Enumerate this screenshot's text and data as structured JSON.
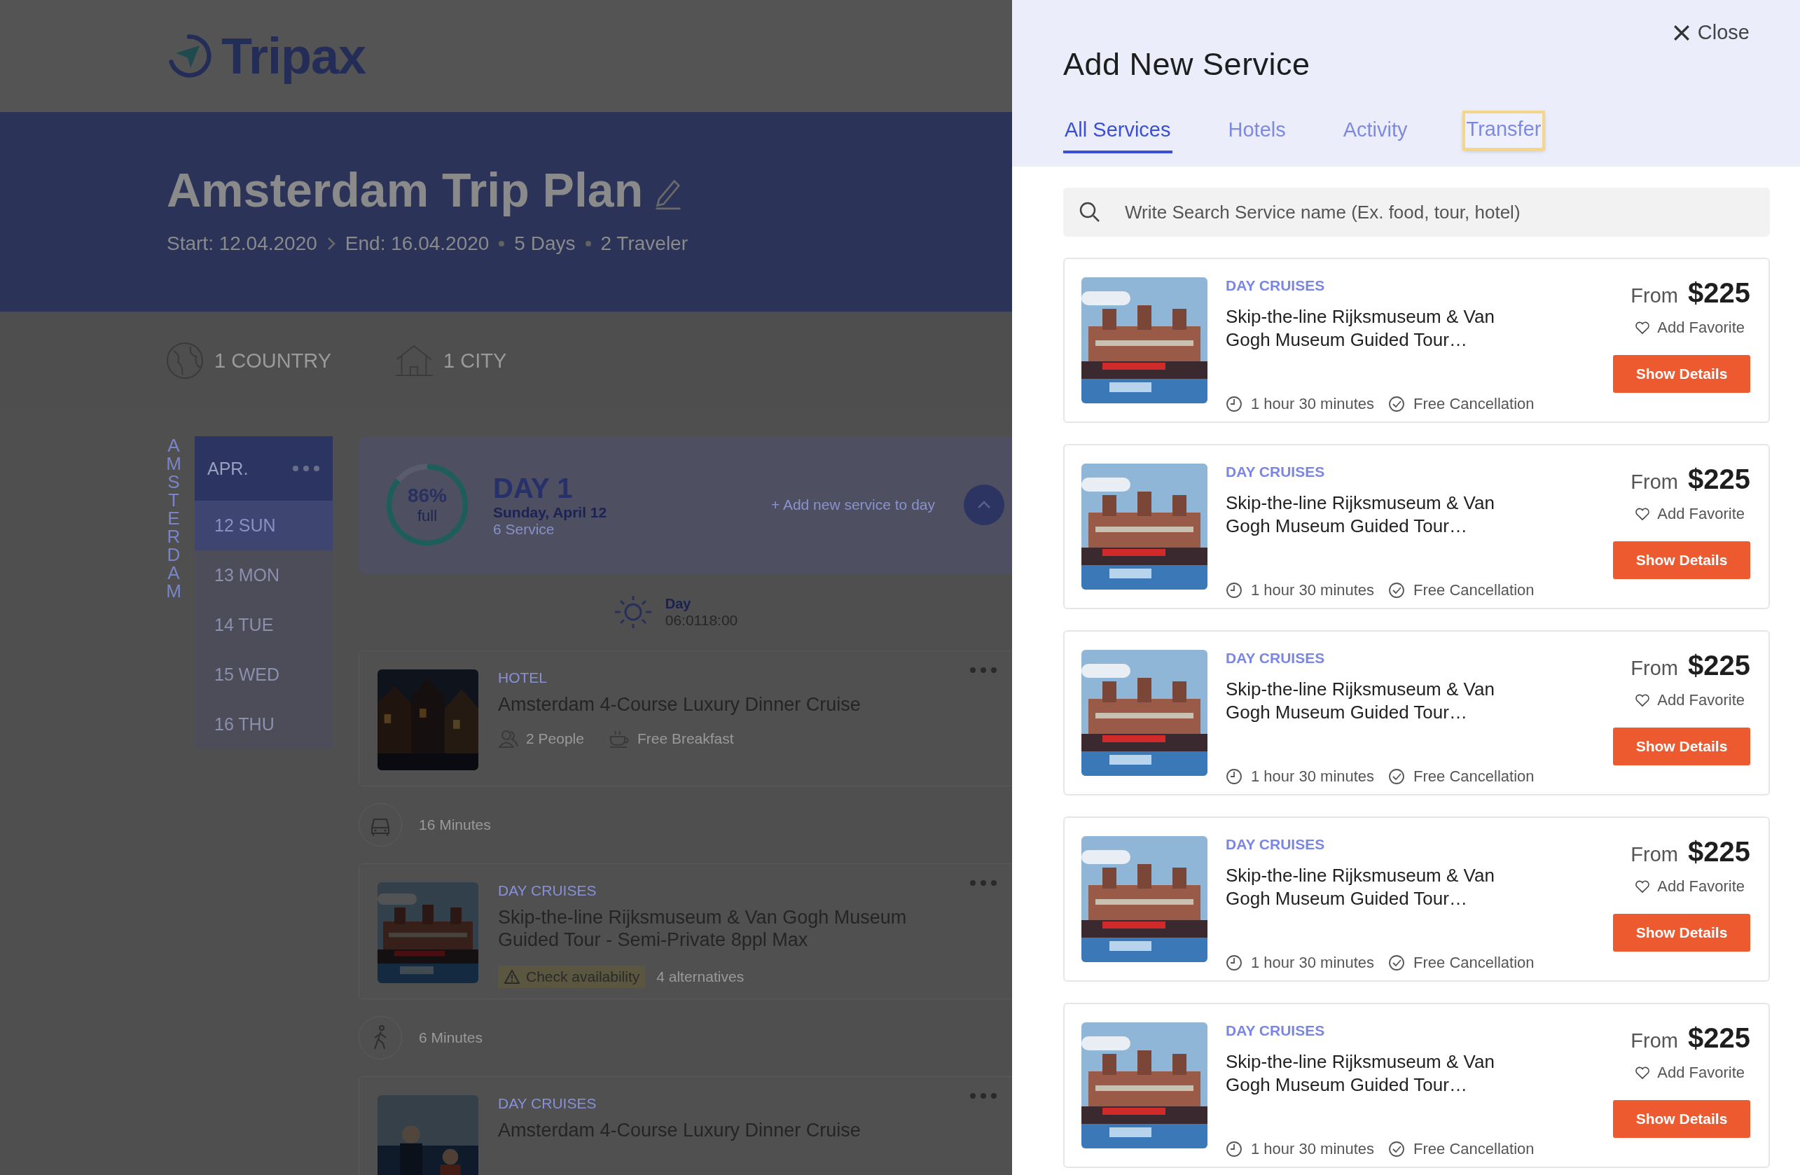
{
  "logo": {
    "text": "Tripax"
  },
  "trip": {
    "title": "Amsterdam Trip Plan",
    "start": "Start: 12.04.2020",
    "end": "End: 16.04.2020",
    "days": "5 Days",
    "travelers": "2 Traveler"
  },
  "stats": [
    {
      "kind": "country",
      "label": "1 COUNTRY"
    },
    {
      "kind": "city",
      "label": "1 CITY"
    }
  ],
  "city_label": "AMSTERDAM",
  "calendar": {
    "month": "APR.",
    "days": [
      {
        "label": "12 SUN",
        "selected": true
      },
      {
        "label": "13 MON",
        "selected": false
      },
      {
        "label": "14 TUE",
        "selected": false
      },
      {
        "label": "15 WED",
        "selected": false
      },
      {
        "label": "16 THU",
        "selected": false
      }
    ]
  },
  "day": {
    "title": "DAY 1",
    "date": "Sunday, April 12",
    "services": "6 Service",
    "percent": "86%",
    "caption": "full",
    "level": 0.86,
    "add_link": "+ Add new service to day"
  },
  "daylight": {
    "label": "Day",
    "time": "06:0118:00"
  },
  "itinerary": [
    {
      "kind": "service",
      "category": "HOTEL",
      "title": "Amsterdam 4-Course Luxury Dinner Cruise",
      "details": [
        {
          "kind": "people",
          "text": "2 People"
        },
        {
          "kind": "breakfast",
          "text": "Free Breakfast"
        }
      ]
    },
    {
      "kind": "drive",
      "text": "16 Minutes"
    },
    {
      "kind": "service",
      "category": "DAY CRUISES",
      "title": "Skip-the-line Rijksmuseum & Van Gogh Museum Guided Tour - Semi-Private 8ppl Max",
      "warning": "Check availability",
      "alternatives": "4 alternatives"
    },
    {
      "kind": "walk",
      "text": "6 Minutes"
    },
    {
      "kind": "service",
      "category": "DAY CRUISES",
      "title": "Amsterdam 4-Course Luxury Dinner Cruise"
    }
  ],
  "panel": {
    "close": "Close",
    "title": "Add New Service",
    "tabs": [
      {
        "label": "All Services",
        "selected": true,
        "focused": false
      },
      {
        "label": "Hotels",
        "selected": false,
        "focused": false
      },
      {
        "label": "Activity",
        "selected": false,
        "focused": false
      },
      {
        "label": "Transfer",
        "selected": false,
        "focused": true
      }
    ],
    "search": {
      "placeholder": "Write Search Service name (Ex. food, tour, hotel)"
    },
    "results": [
      {
        "category": "DAY CRUISES",
        "title": "Skip-the-line Rijksmuseum & Van Gogh Museum Guided Tour…",
        "duration": "1 hour 30 minutes",
        "cancellation": "Free Cancellation",
        "from": "From",
        "price": "$225",
        "favorite": "Add Favorite",
        "button": "Show Details"
      },
      {
        "category": "DAY CRUISES",
        "title": "Skip-the-line Rijksmuseum & Van Gogh Museum Guided Tour…",
        "duration": "1 hour 30 minutes",
        "cancellation": "Free Cancellation",
        "from": "From",
        "price": "$225",
        "favorite": "Add Favorite",
        "button": "Show Details"
      },
      {
        "category": "DAY CRUISES",
        "title": "Skip-the-line Rijksmuseum & Van Gogh Museum Guided Tour…",
        "duration": "1 hour 30 minutes",
        "cancellation": "Free Cancellation",
        "from": "From",
        "price": "$225",
        "favorite": "Add Favorite",
        "button": "Show Details"
      },
      {
        "category": "DAY CRUISES",
        "title": "Skip-the-line Rijksmuseum & Van Gogh Museum Guided Tour…",
        "duration": "1 hour 30 minutes",
        "cancellation": "Free Cancellation",
        "from": "From",
        "price": "$225",
        "favorite": "Add Favorite",
        "button": "Show Details"
      },
      {
        "category": "DAY CRUISES",
        "title": "Skip-the-line Rijksmuseum & Van Gogh Museum Guided Tour…",
        "duration": "1 hour 30 minutes",
        "cancellation": "Free Cancellation",
        "from": "From",
        "price": "$225",
        "favorite": "Add Favorite",
        "button": "Show Details"
      }
    ]
  }
}
